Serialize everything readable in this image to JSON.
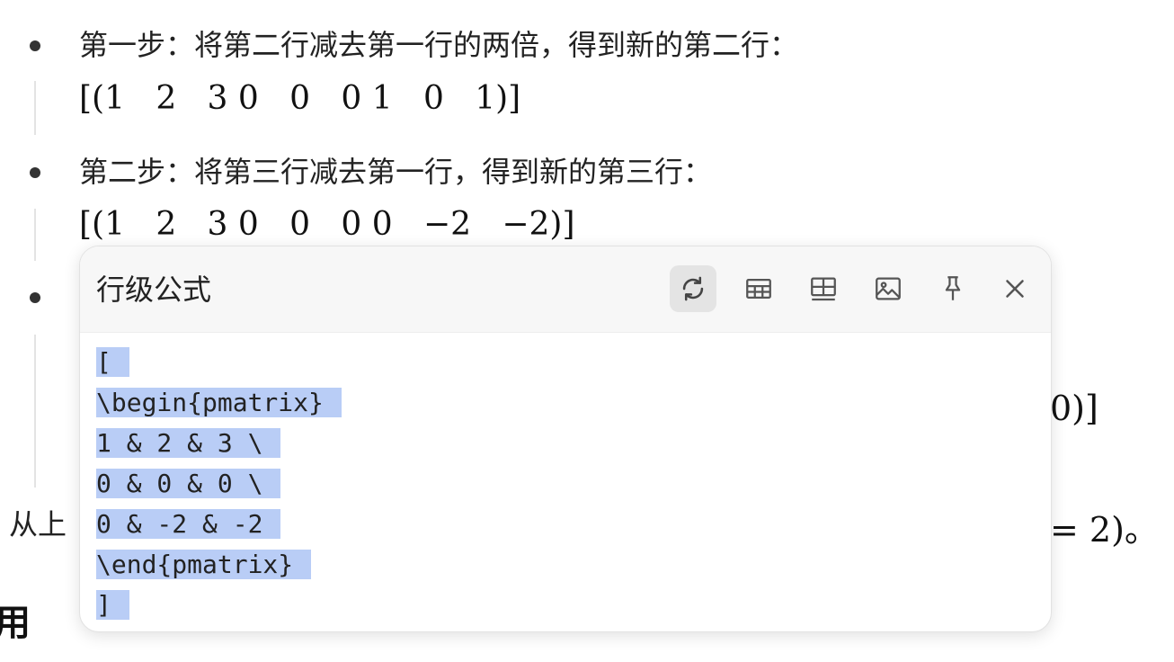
{
  "steps": [
    {
      "text": "第一步：将第二行减去第一行的两倍，得到新的第二行：",
      "formula": "[(1   2   3 0   0   0 1   0   1)]"
    },
    {
      "text": "第二步：将第三行减去第一行，得到新的第三行：",
      "formula": "[(1   2   3 0   0   0 0   −2   −2)]"
    }
  ],
  "hidden_step_formula_tail": "0)]",
  "conclusion_visible_start": "从上",
  "conclusion_visible_end": "= 2)。",
  "heading_fragment": "用",
  "popup": {
    "title": "行级公式",
    "tools": [
      {
        "name": "refresh-icon",
        "active": true
      },
      {
        "name": "table-icon",
        "active": false
      },
      {
        "name": "grid-table-icon",
        "active": false
      },
      {
        "name": "image-icon",
        "active": false
      },
      {
        "name": "pin-icon",
        "active": false
      },
      {
        "name": "close-icon",
        "active": false
      }
    ],
    "code_lines": [
      "[",
      "\\begin{pmatrix}",
      "1 & 2 & 3 \\",
      "0 & 0 & 0 \\",
      "0 & -2 & -2",
      "\\end{pmatrix}",
      "]"
    ]
  },
  "colors": {
    "selection": "#b9cdf6",
    "popup_header": "#f7f7f7",
    "active_tool": "#e4e4e4"
  }
}
